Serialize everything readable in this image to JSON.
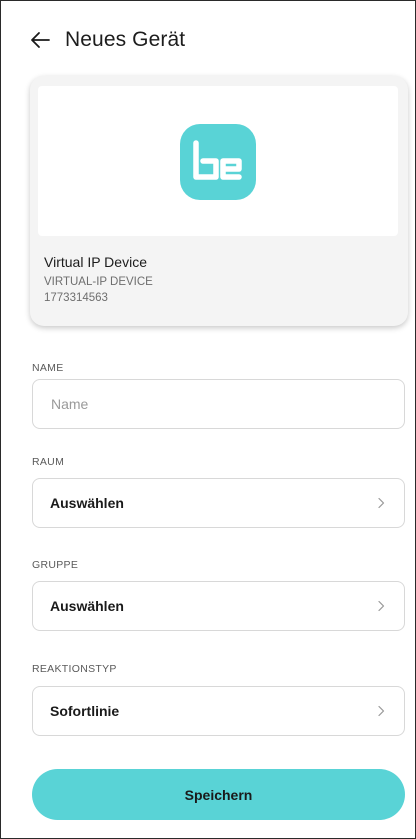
{
  "header": {
    "title": "Neues Gerät",
    "back_icon": "arrow-left-icon"
  },
  "device": {
    "logo_text": "be",
    "logo_color": "#59d3d6",
    "name": "Virtual IP Device",
    "model": "VIRTUAL-IP DEVICE",
    "serial": "1773314563"
  },
  "form": {
    "name": {
      "label": "NAME",
      "placeholder": "Name",
      "value": ""
    },
    "room": {
      "label": "RAUM",
      "value": "Auswählen"
    },
    "group": {
      "label": "GRUPPE",
      "value": "Auswählen"
    },
    "reaction_type": {
      "label": "REAKTIONSTYP",
      "value": "Sofortlinie"
    }
  },
  "actions": {
    "save_label": "Speichern",
    "save_color": "#59d3d6"
  }
}
